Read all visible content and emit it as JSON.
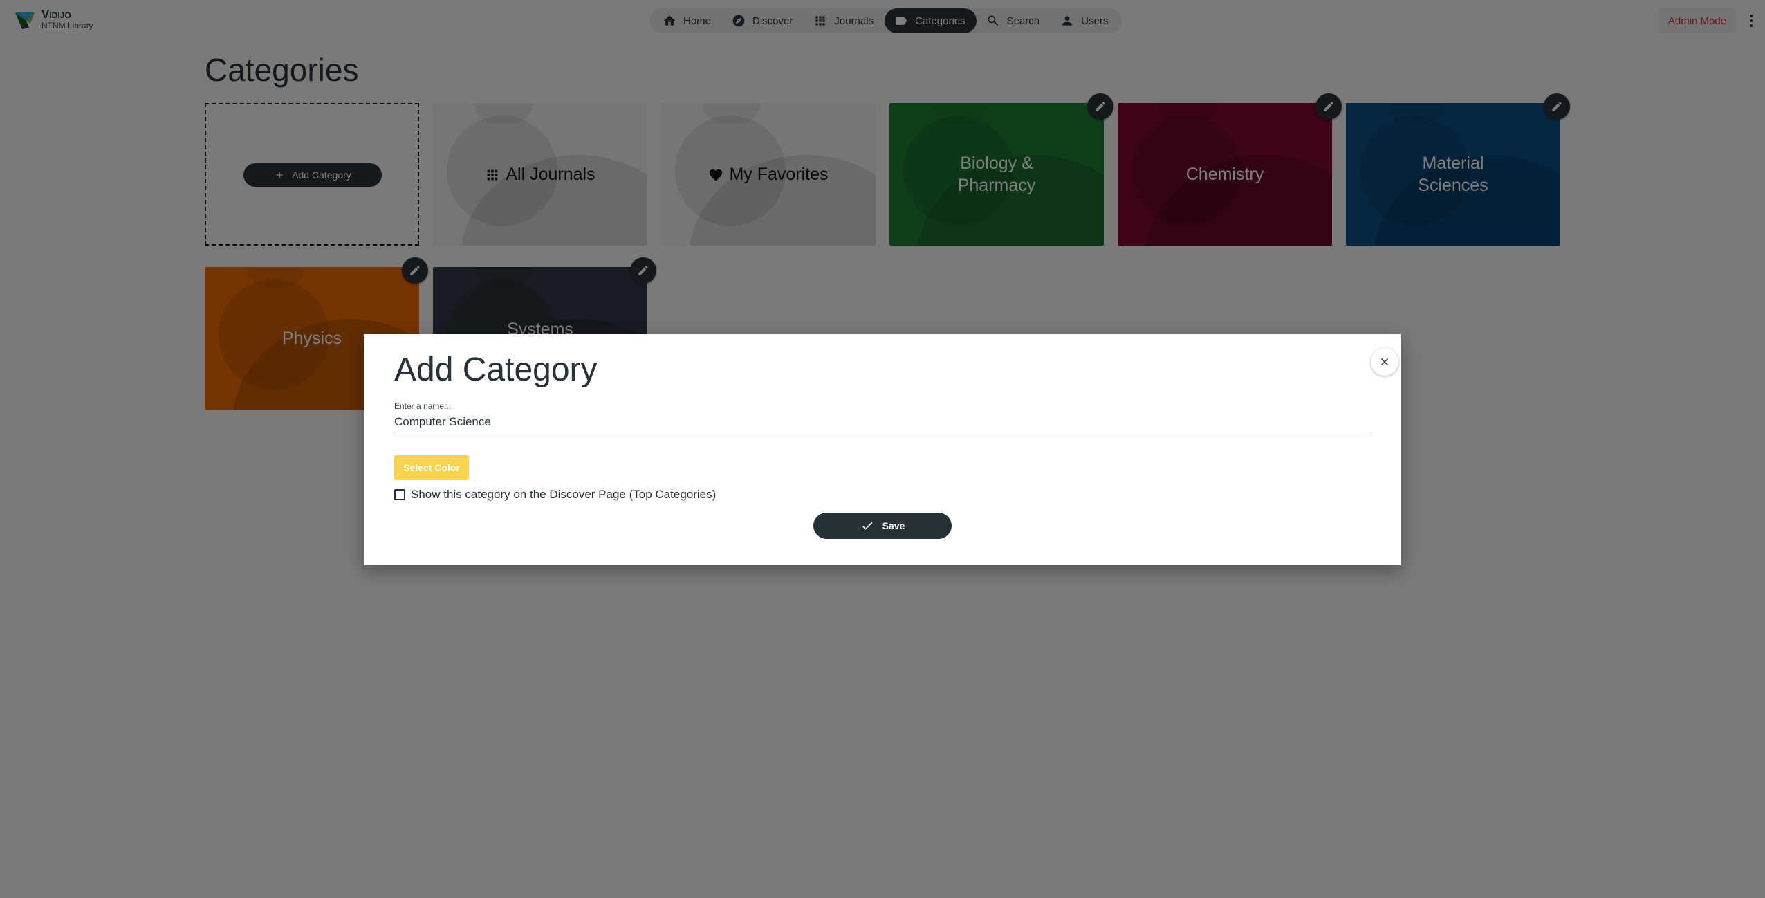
{
  "app": {
    "name": "Vidijo",
    "subtitle": "NTNM Library"
  },
  "nav": {
    "items": [
      {
        "label": "Home",
        "icon": "home-icon"
      },
      {
        "label": "Discover",
        "icon": "compass-icon"
      },
      {
        "label": "Journals",
        "icon": "grid-icon"
      },
      {
        "label": "Categories",
        "icon": "tag-icon",
        "active": true
      },
      {
        "label": "Search",
        "icon": "search-icon"
      },
      {
        "label": "Users",
        "icon": "user-icon"
      }
    ]
  },
  "admin_mode_label": "Admin Mode",
  "page_title": "Categories",
  "add_category_button": "Add Category",
  "cards": [
    {
      "label": "All Journals",
      "icon": "grid-icon",
      "color": "#ececec"
    },
    {
      "label": "My Favorites",
      "icon": "heart-icon",
      "color": "#ececec"
    },
    {
      "label": "Biology & Pharmacy",
      "color": "#1e7e34"
    },
    {
      "label": "Chemistry",
      "color": "#7a0a2e"
    },
    {
      "label": "Material Sciences",
      "color": "#0d4f82"
    },
    {
      "label": "Physics",
      "color": "#e86b05"
    },
    {
      "label": "Systems",
      "color": "#2f3a45"
    }
  ],
  "dialog": {
    "title": "Add Category",
    "name_label": "Enter a name...",
    "name_value": "Computer Science",
    "select_color_label": "Select Color",
    "checkbox_label": "Show this category on the Discover Page (Top Categories)",
    "checkbox_checked": false,
    "save_label": "Save"
  },
  "colors": {
    "primary": "#263238",
    "accent": "#f9d34a",
    "admin": "#d32f2f"
  }
}
